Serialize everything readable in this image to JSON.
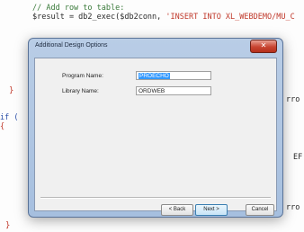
{
  "editor": {
    "line1_comment": "// Add row to table:",
    "line2_code": "$result = db2_exec($db2conn, ",
    "line2_string": "'INSERT INTO XL_WEBDEMO/MU_C",
    "frag_rro1": "rro",
    "frag_if": "if (",
    "frag_brace_open": "{",
    "frag_ef": "EF",
    "frag_rro2": "rro",
    "brace_close_1": "}",
    "brace_close_2": "}",
    "brace_close_3": "}"
  },
  "dialog": {
    "title": "Additional Design Options",
    "close_glyph": "✕",
    "program_label": "Program Name:",
    "program_value": "PROECHO",
    "library_label": "Library Name:",
    "library_value": "ORDWEB",
    "back_label": "< Back",
    "next_label": "Next >",
    "cancel_label": "Cancel"
  }
}
